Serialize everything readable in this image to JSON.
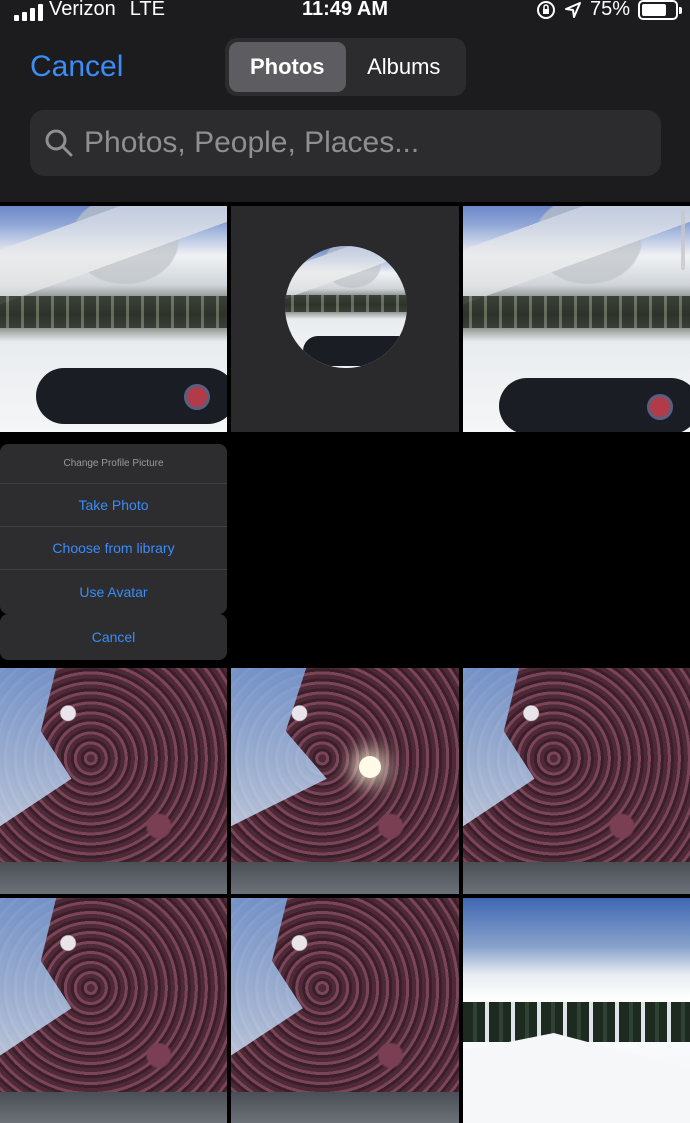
{
  "status_bar": {
    "carrier": "Verizon",
    "network": "LTE",
    "time": "11:49 AM",
    "battery": "75%",
    "battery_level": 0.75
  },
  "header": {
    "cancel_label": "Cancel",
    "tabs": [
      {
        "label": "Photos",
        "active": true
      },
      {
        "label": "Albums",
        "active": false
      }
    ]
  },
  "search": {
    "placeholder": "Photos, People, Places..."
  },
  "action_sheet": {
    "title": "Change Profile Picture",
    "items": [
      "Take Photo",
      "Choose from library",
      "Use Avatar"
    ],
    "cancel_label": "Cancel"
  },
  "colors": {
    "accent": "#3a8cf7",
    "chrome_bg": "#1c1c1e",
    "field_bg": "#2c2c2e"
  },
  "icons": [
    "signal-bars-icon",
    "lock-rotation-icon",
    "location-arrow-icon",
    "battery-icon",
    "search-icon"
  ]
}
